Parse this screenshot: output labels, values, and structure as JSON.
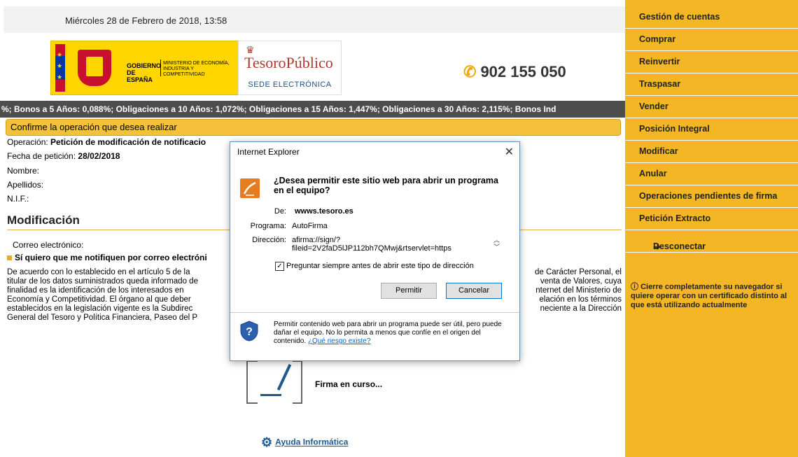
{
  "header": {
    "datetime": "Miércoles 28 de Febrero de 2018, 13:58",
    "gobierno": "GOBIERNO DE ESPAÑA",
    "ministerio": "MINISTERIO DE ECONOMÍA, INDUSTRIA Y COMPETITIVIDAD",
    "tesoro_name": "TesoroPúblico",
    "tesoro_sede": "SEDE ELECTRÓNICA",
    "phone": "902 155 050"
  },
  "ticker": "%; Bonos a 5 Años: 0,088%; Obligaciones a 10 Años: 1,072%; Obligaciones a 15 Años: 1,447%; Obligaciones a 30 Años: 2,115%; Bonos Ind",
  "main": {
    "confirm_title": "Confirme la operación que desea realizar",
    "operacion_label": "Operación:",
    "operacion_value": "Petición de modificación de notificacio",
    "fecha_label": "Fecha de petición:",
    "fecha_value": "28/02/2018",
    "nombre_label": "Nombre:",
    "apellidos_label": "Apellidos:",
    "nif_label": "N.I.F.:",
    "mod_title": "Modificación",
    "email_label": "Correo electrónico:",
    "notify_label": "Sí quiero que me notifiquen por correo electróni",
    "text_left": [
      "De acuerdo con lo establecido en el artículo 5 de la",
      "titular de los datos suministrados queda informado de",
      "finalidad es la identificación de los interesados en",
      "Economía y Competitividad. El órgano al que deber",
      "establecidos en la legislación vigente es la Subdirec",
      "General del Tesoro y Política Financiera, Paseo del P"
    ],
    "text_right": [
      "de Carácter Personal, el",
      "venta de Valores, cuya",
      "nternet del Ministerio de",
      "elación en los términos",
      "neciente a la Dirección"
    ],
    "firma_text": "Firma en curso...",
    "help_link": "Ayuda Informática"
  },
  "sidebar": {
    "items": [
      "Gestión de cuentas",
      "Comprar",
      "Reinvertir",
      "Traspasar",
      "Vender",
      "Posición Integral",
      "Modificar",
      "Anular",
      "Operaciones pendientes de firma",
      "Petición Extracto",
      "Desconectar"
    ],
    "notice": "Cierre completamente su navegador si quiere operar con un certificado distinto al que está utilizando actualmente"
  },
  "dialog": {
    "title": "Internet Explorer",
    "question": "¿Desea permitir este sitio web para abrir un programa en el equipo?",
    "de_label": "De:",
    "de_value": "wwws.tesoro.es",
    "programa_label": "Programa:",
    "programa_value": "AutoFirma",
    "direccion_label": "Dirección:",
    "direccion_line1": "afirma://sign/?",
    "direccion_line2": "fileid=2V2faD5lJP112bh7QMwj&rtservlet=https",
    "checkbox_label": "Preguntar siempre antes de abrir este tipo de dirección",
    "allow_button": "Permitir",
    "cancel_button": "Cancelar",
    "warning_text": "Permitir contenido web para abrir un programa puede ser útil, pero puede dañar el equipo. No lo permita a menos que confíe en el origen del contenido.",
    "warning_link": "¿Qué riesgo existe?"
  },
  "colors": {
    "sidebar_bg": "#f5b625",
    "ticker_bg": "#4d4d4d",
    "link": "#1e5a8e"
  }
}
